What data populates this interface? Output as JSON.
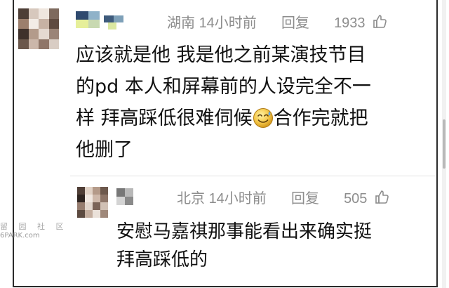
{
  "comments": [
    {
      "location": "湖南",
      "time": "14小时前",
      "reply_label": "回复",
      "likes": "1933",
      "lines": [
        "应该就是他 我是他之前某演技节目",
        "的pd 本人和屏幕前的人设完全不一",
        "样 拜高踩低很难伺候"
      ],
      "line3_tail": "合作完就把",
      "line4": "他删了",
      "emoji": "smile-sweat-emoji"
    }
  ],
  "reply": {
    "location": "北京",
    "time": "14小时前",
    "reply_label": "回复",
    "likes": "505",
    "lines": [
      "安慰马嘉祺那事能看出来确实挺",
      "拜高踩低的"
    ]
  },
  "watermark": {
    "glyphs": "留 园 社 区",
    "site": "6PARK.com"
  },
  "icons": {
    "like": "thumbs-up-icon",
    "emoji": "smile-sweat-emoji"
  },
  "colors": {
    "meta": "#8d8d8d",
    "text": "#111111",
    "border": "#2b2b2b"
  }
}
